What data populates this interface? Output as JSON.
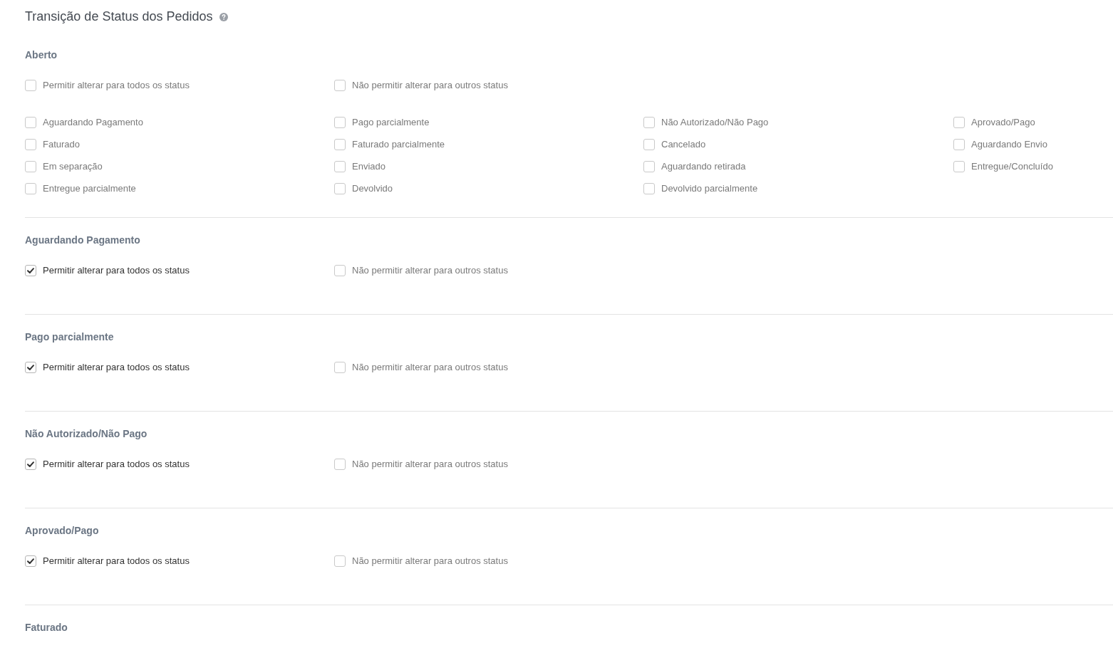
{
  "title": "Transição de Status dos Pedidos",
  "sections": [
    {
      "heading": "Aberto",
      "options": [
        {
          "label": "Permitir alterar para todos os status",
          "checked": false
        },
        {
          "label": "Não permitir alterar para outros status",
          "checked": false
        }
      ],
      "statuses": [
        {
          "label": "Aguardando Pagamento",
          "checked": false
        },
        {
          "label": "Pago parcialmente",
          "checked": false
        },
        {
          "label": "Não Autorizado/Não Pago",
          "checked": false
        },
        {
          "label": "Aprovado/Pago",
          "checked": false
        },
        {
          "label": "Faturado",
          "checked": false
        },
        {
          "label": "Faturado parcialmente",
          "checked": false
        },
        {
          "label": "Cancelado",
          "checked": false
        },
        {
          "label": "Aguardando Envio",
          "checked": false
        },
        {
          "label": "Em separação",
          "checked": false
        },
        {
          "label": "Enviado",
          "checked": false
        },
        {
          "label": "Aguardando retirada",
          "checked": false
        },
        {
          "label": "Entregue/Concluído",
          "checked": false
        },
        {
          "label": "Entregue parcialmente",
          "checked": false
        },
        {
          "label": "Devolvido",
          "checked": false
        },
        {
          "label": "Devolvido parcialmente",
          "checked": false
        }
      ]
    },
    {
      "heading": "Aguardando Pagamento",
      "options": [
        {
          "label": "Permitir alterar para todos os status",
          "checked": true
        },
        {
          "label": "Não permitir alterar para outros status",
          "checked": false
        }
      ]
    },
    {
      "heading": "Pago parcialmente",
      "options": [
        {
          "label": "Permitir alterar para todos os status",
          "checked": true
        },
        {
          "label": "Não permitir alterar para outros status",
          "checked": false
        }
      ]
    },
    {
      "heading": "Não Autorizado/Não Pago",
      "options": [
        {
          "label": "Permitir alterar para todos os status",
          "checked": true
        },
        {
          "label": "Não permitir alterar para outros status",
          "checked": false
        }
      ]
    },
    {
      "heading": "Aprovado/Pago",
      "options": [
        {
          "label": "Permitir alterar para todos os status",
          "checked": true
        },
        {
          "label": "Não permitir alterar para outros status",
          "checked": false
        }
      ]
    },
    {
      "heading": "Faturado"
    }
  ]
}
